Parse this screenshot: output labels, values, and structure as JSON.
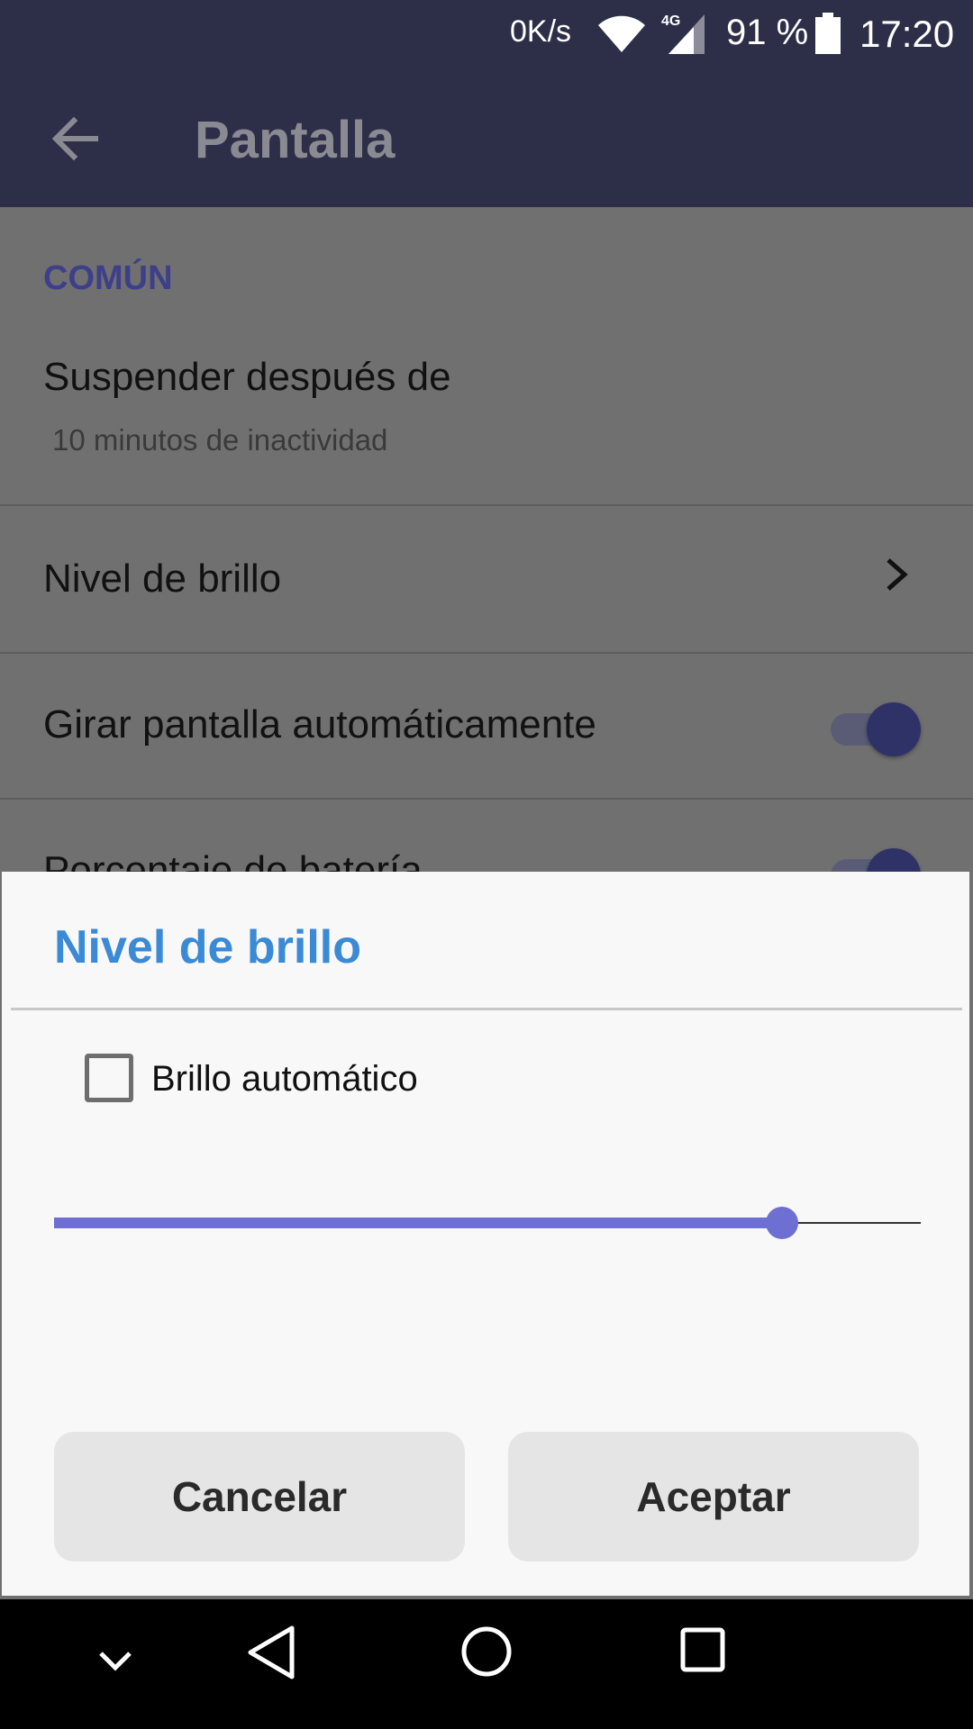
{
  "status_bar": {
    "network_speed": "0K/s",
    "battery_percent": "91 %",
    "time": "17:20",
    "icons": [
      "wifi-icon",
      "cell-4g-icon",
      "battery-icon"
    ]
  },
  "app_bar": {
    "title": "Pantalla",
    "back_icon": "arrow-left-icon"
  },
  "settings": {
    "section_header": "COMÚN",
    "items": [
      {
        "title": "Suspender después de",
        "subtitle": "10 minutos de inactividad"
      },
      {
        "title": "Nivel de brillo",
        "icon": "chevron-right-icon"
      },
      {
        "title": "Girar pantalla automáticamente",
        "toggle": true
      },
      {
        "title": "Porcentaje de batería",
        "toggle": true
      }
    ]
  },
  "dialog": {
    "title": "Nivel de brillo",
    "checkbox_label": "Brillo automático",
    "checkbox_checked": false,
    "brightness_fraction": 0.84,
    "cancel_label": "Cancelar",
    "accept_label": "Aceptar",
    "accent_color": "#6e6fd2",
    "title_color": "#3a8ad6"
  },
  "nav_bar": {
    "icons": [
      "chevron-down-icon",
      "back-triangle-icon",
      "home-circle-icon",
      "recents-square-icon"
    ]
  }
}
